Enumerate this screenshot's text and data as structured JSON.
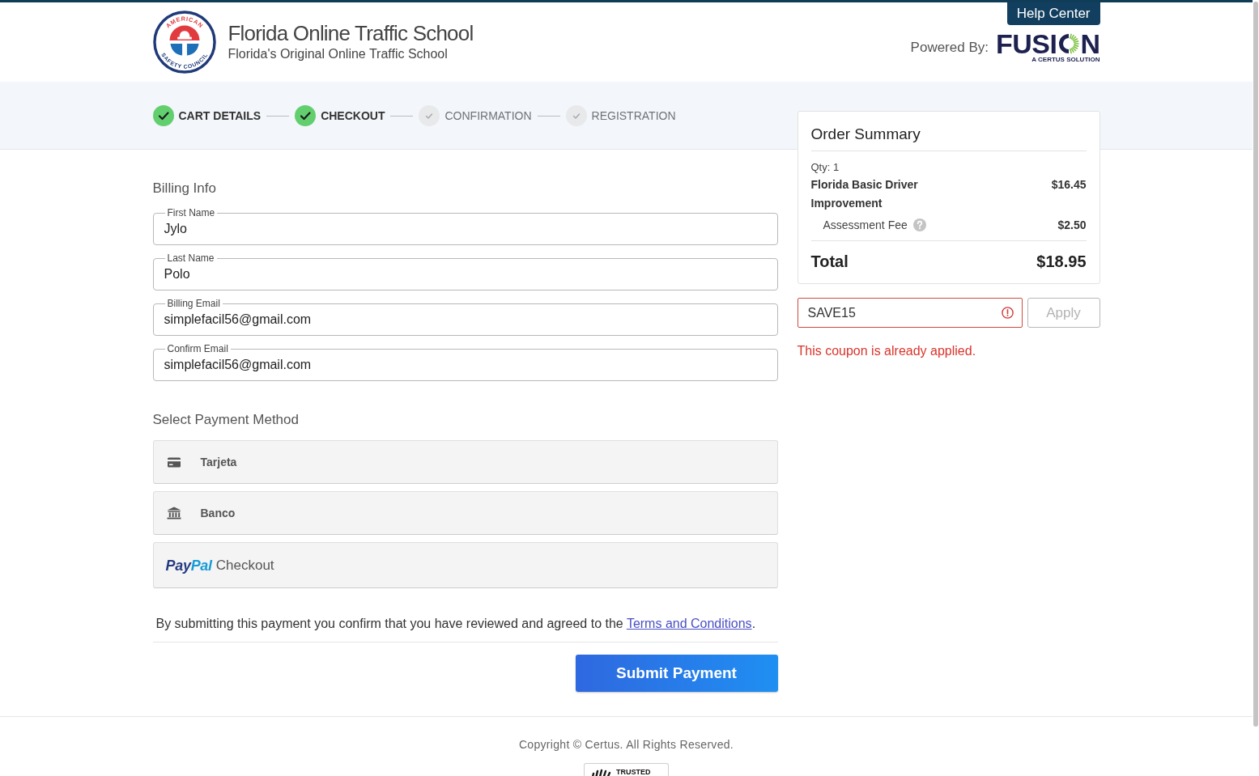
{
  "header": {
    "logo": {
      "ring_top": "AMERICAN",
      "ring_bottom": "SAFETY COUNCIL"
    },
    "title": "Florida Online Traffic School",
    "subtitle": "Florida's Original Online Traffic School",
    "help_button": "Help Center",
    "powered_by": "Powered By:",
    "partner_logo": {
      "wordmark_before_ring": "FUSI",
      "wordmark_after_ring": "N",
      "tagline": "A CERTUS SOLUTION"
    }
  },
  "steps": [
    {
      "label": "CART DETAILS",
      "completed": true
    },
    {
      "label": "CHECKOUT",
      "completed": true
    },
    {
      "label": "CONFIRMATION",
      "completed": false
    },
    {
      "label": "REGISTRATION",
      "completed": false
    }
  ],
  "billing": {
    "title": "Billing Info",
    "fields": [
      {
        "label": "First Name",
        "value": "Jylo"
      },
      {
        "label": "Last Name",
        "value": "Polo"
      },
      {
        "label": "Billing Email",
        "value": "simplefacil56@gmail.com"
      },
      {
        "label": "Confirm Email",
        "value": "simplefacil56@gmail.com"
      }
    ]
  },
  "payment": {
    "title": "Select Payment Method",
    "methods": [
      {
        "kind": "card",
        "label": "Tarjeta"
      },
      {
        "kind": "bank",
        "label": "Banco"
      },
      {
        "kind": "paypal",
        "logo": [
          "Pay",
          "Pal"
        ],
        "label": "Checkout"
      }
    ]
  },
  "terms": {
    "text": "By submitting this payment you confirm that you have reviewed and agreed to the",
    "link": "Terms and Conditions",
    "after": "."
  },
  "submit_button": "Submit Payment",
  "order_summary": {
    "title": "Order Summary",
    "quantity": "Qty: 1",
    "lines": [
      {
        "kind": "product",
        "name": "Florida Basic Driver Improvement",
        "price": "$16.45"
      },
      {
        "kind": "fee",
        "name": "Assessment Fee",
        "price": "$2.50"
      }
    ],
    "total_label": "Total",
    "total": "$18.95"
  },
  "coupon": {
    "value": "SAVE15",
    "invalid": true,
    "button": "Apply",
    "button_disabled": true,
    "error": "This coupon is already applied."
  },
  "footer": {
    "copyright": "Copyright © Certus. All Rights Reserved.",
    "seal_text": "TRUSTED"
  }
}
